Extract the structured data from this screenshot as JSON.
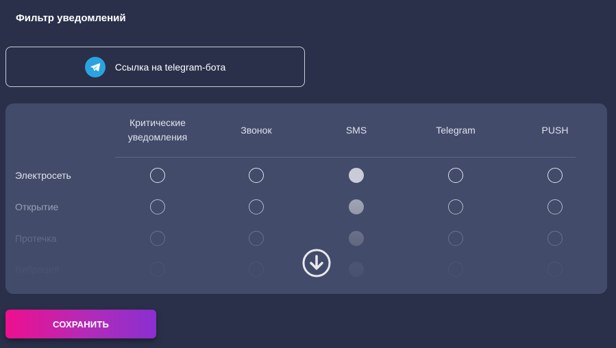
{
  "page": {
    "title": "Фильтр уведомлений"
  },
  "telegram": {
    "link_label": "Ссылка на telegram-бота",
    "icon": "telegram-icon"
  },
  "table": {
    "columns": [
      {
        "key": "critical",
        "label": "Критические уведомления"
      },
      {
        "key": "call",
        "label": "Звонок"
      },
      {
        "key": "sms",
        "label": "SMS"
      },
      {
        "key": "telegram",
        "label": "Telegram"
      },
      {
        "key": "push",
        "label": "PUSH"
      }
    ],
    "rows": [
      {
        "label": "Электросеть",
        "values": [
          false,
          false,
          true,
          false,
          false
        ]
      },
      {
        "label": "Открытие",
        "values": [
          false,
          false,
          true,
          false,
          false
        ]
      },
      {
        "label": "Протечка",
        "values": [
          false,
          false,
          true,
          false,
          false
        ]
      },
      {
        "label": "Вибрация",
        "values": [
          false,
          false,
          true,
          false,
          false
        ]
      }
    ]
  },
  "scroll_icon": "arrow-down-circle-icon",
  "actions": {
    "save_label": "СОХРАНИТЬ"
  },
  "colors": {
    "background": "#2a3049",
    "panel": "#424b6a",
    "telegram_blue": "#2aa3e0",
    "save_gradient_start": "#ee0f8e",
    "save_gradient_end": "#8a2fd0"
  }
}
